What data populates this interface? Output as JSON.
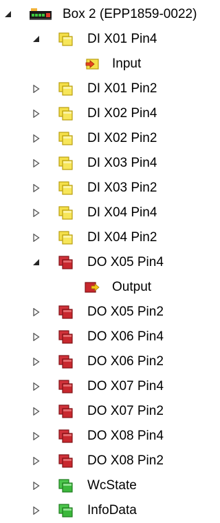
{
  "tree": {
    "box": {
      "label": "Box 2 (EPP1859-0022)",
      "expanded": true,
      "icon": "box-device-icon"
    },
    "di_x01_pin4": {
      "label": "DI X01 Pin4",
      "expanded": true,
      "icon": "input-module-icon",
      "color": "#f5e04a"
    },
    "input": {
      "label": "Input",
      "icon": "input-variable-icon"
    },
    "di_x01_pin2": {
      "label": "DI X01 Pin2",
      "expanded": false,
      "icon": "input-module-icon"
    },
    "di_x02_pin4": {
      "label": "DI X02 Pin4",
      "expanded": false,
      "icon": "input-module-icon"
    },
    "di_x02_pin2": {
      "label": "DI X02 Pin2",
      "expanded": false,
      "icon": "input-module-icon"
    },
    "di_x03_pin4": {
      "label": "DI X03 Pin4",
      "expanded": false,
      "icon": "input-module-icon"
    },
    "di_x03_pin2": {
      "label": "DI X03 Pin2",
      "expanded": false,
      "icon": "input-module-icon"
    },
    "di_x04_pin4": {
      "label": "DI X04 Pin4",
      "expanded": false,
      "icon": "input-module-icon"
    },
    "di_x04_pin2": {
      "label": "DI X04 Pin2",
      "expanded": false,
      "icon": "input-module-icon"
    },
    "do_x05_pin4": {
      "label": "DO X05 Pin4",
      "expanded": true,
      "icon": "output-module-icon",
      "color": "#c8282e"
    },
    "output": {
      "label": "Output",
      "icon": "output-variable-icon"
    },
    "do_x05_pin2": {
      "label": "DO X05 Pin2",
      "expanded": false,
      "icon": "output-module-icon"
    },
    "do_x06_pin4": {
      "label": "DO X06 Pin4",
      "expanded": false,
      "icon": "output-module-icon"
    },
    "do_x06_pin2": {
      "label": "DO X06 Pin2",
      "expanded": false,
      "icon": "output-module-icon"
    },
    "do_x07_pin4": {
      "label": "DO X07 Pin4",
      "expanded": false,
      "icon": "output-module-icon"
    },
    "do_x07_pin2": {
      "label": "DO X07 Pin2",
      "expanded": false,
      "icon": "output-module-icon"
    },
    "do_x08_pin4": {
      "label": "DO X08 Pin4",
      "expanded": false,
      "icon": "output-module-icon"
    },
    "do_x08_pin2": {
      "label": "DO X08 Pin2",
      "expanded": false,
      "icon": "output-module-icon"
    },
    "wcstate": {
      "label": "WcState",
      "expanded": false,
      "icon": "status-module-icon",
      "color": "#3cb83c"
    },
    "infodata": {
      "label": "InfoData",
      "expanded": false,
      "icon": "status-module-icon"
    }
  }
}
